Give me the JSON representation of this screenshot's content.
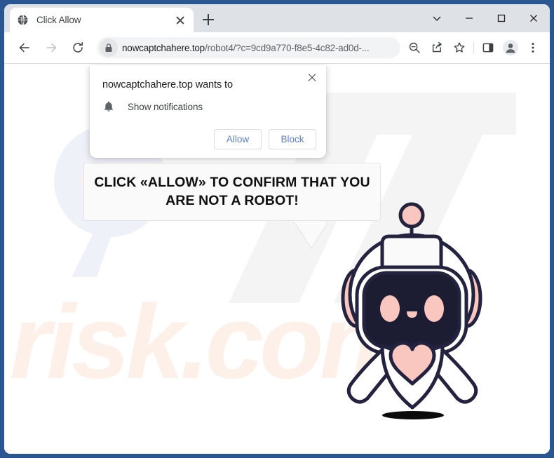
{
  "browser": {
    "tab": {
      "title": "Click Allow",
      "favicon_icon": "globe-icon",
      "close_icon": "close-icon"
    },
    "new_tab_icon": "plus-icon",
    "window_controls": [
      {
        "name": "tab-search",
        "icon": "chevron-down-icon"
      },
      {
        "name": "minimize",
        "icon": "minimize-icon"
      },
      {
        "name": "maximize",
        "icon": "maximize-icon"
      },
      {
        "name": "close",
        "icon": "close-icon"
      }
    ],
    "nav": {
      "back_icon": "arrow-left-icon",
      "forward_icon": "arrow-right-icon",
      "reload_icon": "reload-icon"
    },
    "omnibox": {
      "lock_icon": "lock-icon",
      "host": "nowcaptchahere.top",
      "path": "/robot4/?c=9cd9a770-f8e5-4c82-ad0d-...",
      "full_url": "nowcaptchahere.top/robot4/?c=9cd9a770-f8e5-4c82-ad0d-..."
    },
    "toolbar_icons": [
      {
        "name": "zoom-out-icon",
        "icon": "magnifier-minus-icon"
      },
      {
        "name": "share-icon",
        "icon": "share-icon"
      },
      {
        "name": "bookmark-icon",
        "icon": "star-icon"
      },
      {
        "name": "side-panel-icon",
        "icon": "panel-icon"
      },
      {
        "name": "profile-icon",
        "icon": "avatar-icon"
      },
      {
        "name": "chrome-menu-icon",
        "icon": "three-dots-icon"
      }
    ]
  },
  "permission_dialog": {
    "title": "nowcaptchahere.top wants to",
    "permission_icon": "bell-icon",
    "permission_label": "Show notifications",
    "allow_label": "Allow",
    "block_label": "Block",
    "close_icon": "close-icon"
  },
  "page": {
    "bubble_line1": "CLICK «ALLOW» TO CONFIRM THAT YOU",
    "bubble_line2": "ARE NOT A ROBOT!",
    "mascot": "robot-mascot",
    "watermark_text": "risk.com"
  },
  "colors": {
    "frame_blue": "#2a5691",
    "tabstrip_gray": "#dee1e6",
    "omnibox_gray": "#f1f3f4",
    "link_blue": "#5b7fd4",
    "robot_outline": "#232340",
    "robot_pink": "#f9c7c0",
    "robot_face": "#1c1c33",
    "watermark_peach": "#fdf0e8"
  }
}
